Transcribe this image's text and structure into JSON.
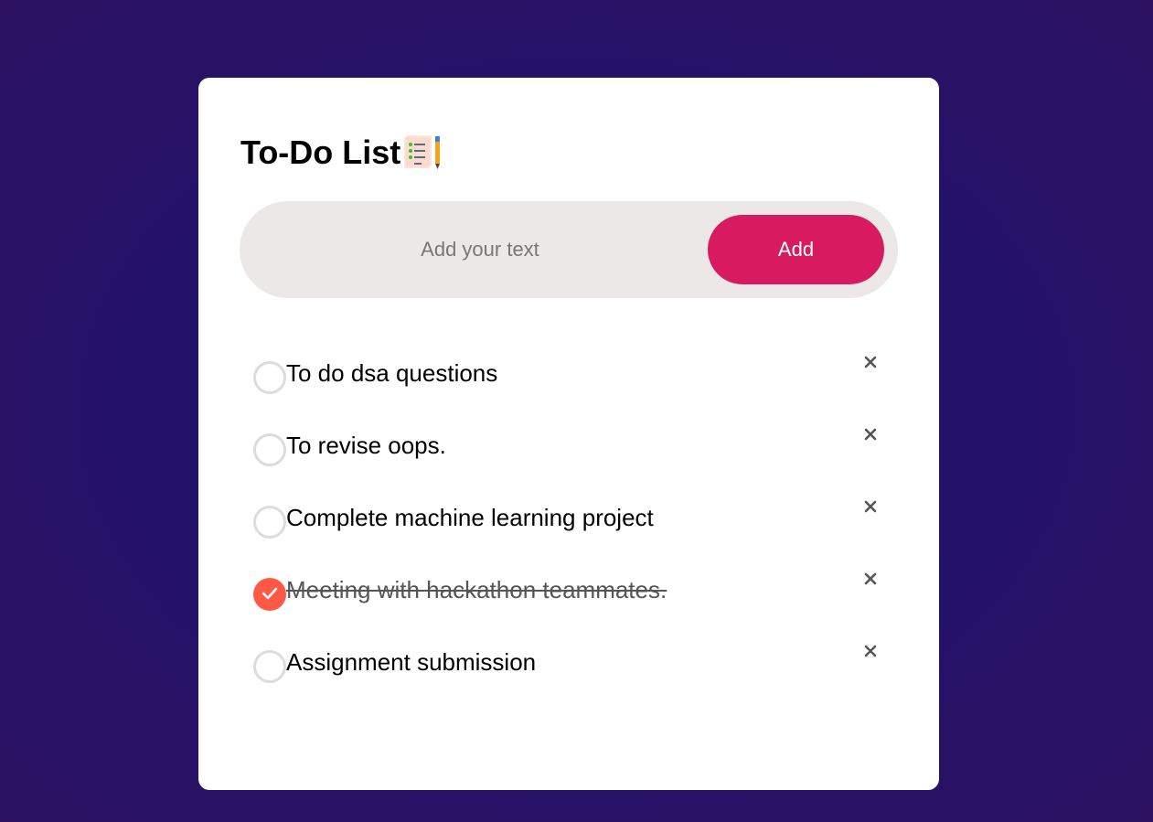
{
  "app": {
    "title": "To-Do List",
    "title_icon": "checklist-clipboard-icon"
  },
  "input": {
    "placeholder": "Add your text",
    "value": ""
  },
  "add_button": {
    "label": "Add"
  },
  "colors": {
    "accent": "#d81b60",
    "checked": "#ff5945",
    "background": "#22126a",
    "input_bg": "#ece8e7"
  },
  "tasks": [
    {
      "text": "To do dsa questions",
      "checked": false
    },
    {
      "text": "To revise oops.",
      "checked": false
    },
    {
      "text": "Complete machine learning project",
      "checked": false
    },
    {
      "text": "Meeting with hackathon teammates.",
      "checked": true
    },
    {
      "text": "Assignment submission",
      "checked": false
    }
  ],
  "icons": {
    "checkbox_checked": "checkmark-icon",
    "delete": "close-icon"
  }
}
